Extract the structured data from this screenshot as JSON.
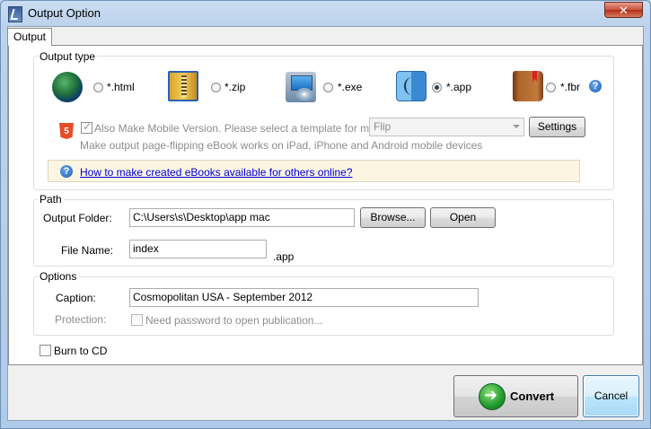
{
  "window": {
    "title": "Output Option",
    "close_label": "✕"
  },
  "tabs": [
    {
      "label": "Output"
    }
  ],
  "output_type": {
    "group_label": "Output type",
    "options": [
      {
        "label": "*.html",
        "icon": "globe-icon",
        "selected": false
      },
      {
        "label": "*.zip",
        "icon": "zip-archive-icon",
        "selected": false
      },
      {
        "label": "*.exe",
        "icon": "computer-cd-icon",
        "selected": false
      },
      {
        "label": "*.app",
        "icon": "mac-finder-icon",
        "selected": true
      },
      {
        "label": "*.fbr",
        "icon": "book-icon",
        "selected": false
      }
    ],
    "help_glyph": "?",
    "mobile_checkbox_label": "Also Make Mobile Version. Please select a template for mobile:",
    "mobile_checked": true,
    "template_value": "Flip",
    "settings_label": "Settings",
    "mobile_note": "Make output page-flipping eBook works on iPad, iPhone and Android mobile devices",
    "html5_badge": "5",
    "info_link": "How to make created eBooks available for others online?"
  },
  "path": {
    "group_label": "Path",
    "output_folder_label": "Output Folder:",
    "output_folder_value": "C:\\Users\\s\\Desktop\\app mac",
    "browse_label": "Browse...",
    "open_label": "Open",
    "file_name_label": "File Name:",
    "file_name_value": "index",
    "extension": ".app"
  },
  "options": {
    "group_label": "Options",
    "caption_label": "Caption:",
    "caption_value": "Cosmopolitan USA - September 2012",
    "protection_label": "Protection:",
    "password_label": "Need password to open publication..."
  },
  "burn_to_cd_label": "Burn to CD",
  "buttons": {
    "convert_label": "Convert",
    "cancel_label": "Cancel"
  }
}
